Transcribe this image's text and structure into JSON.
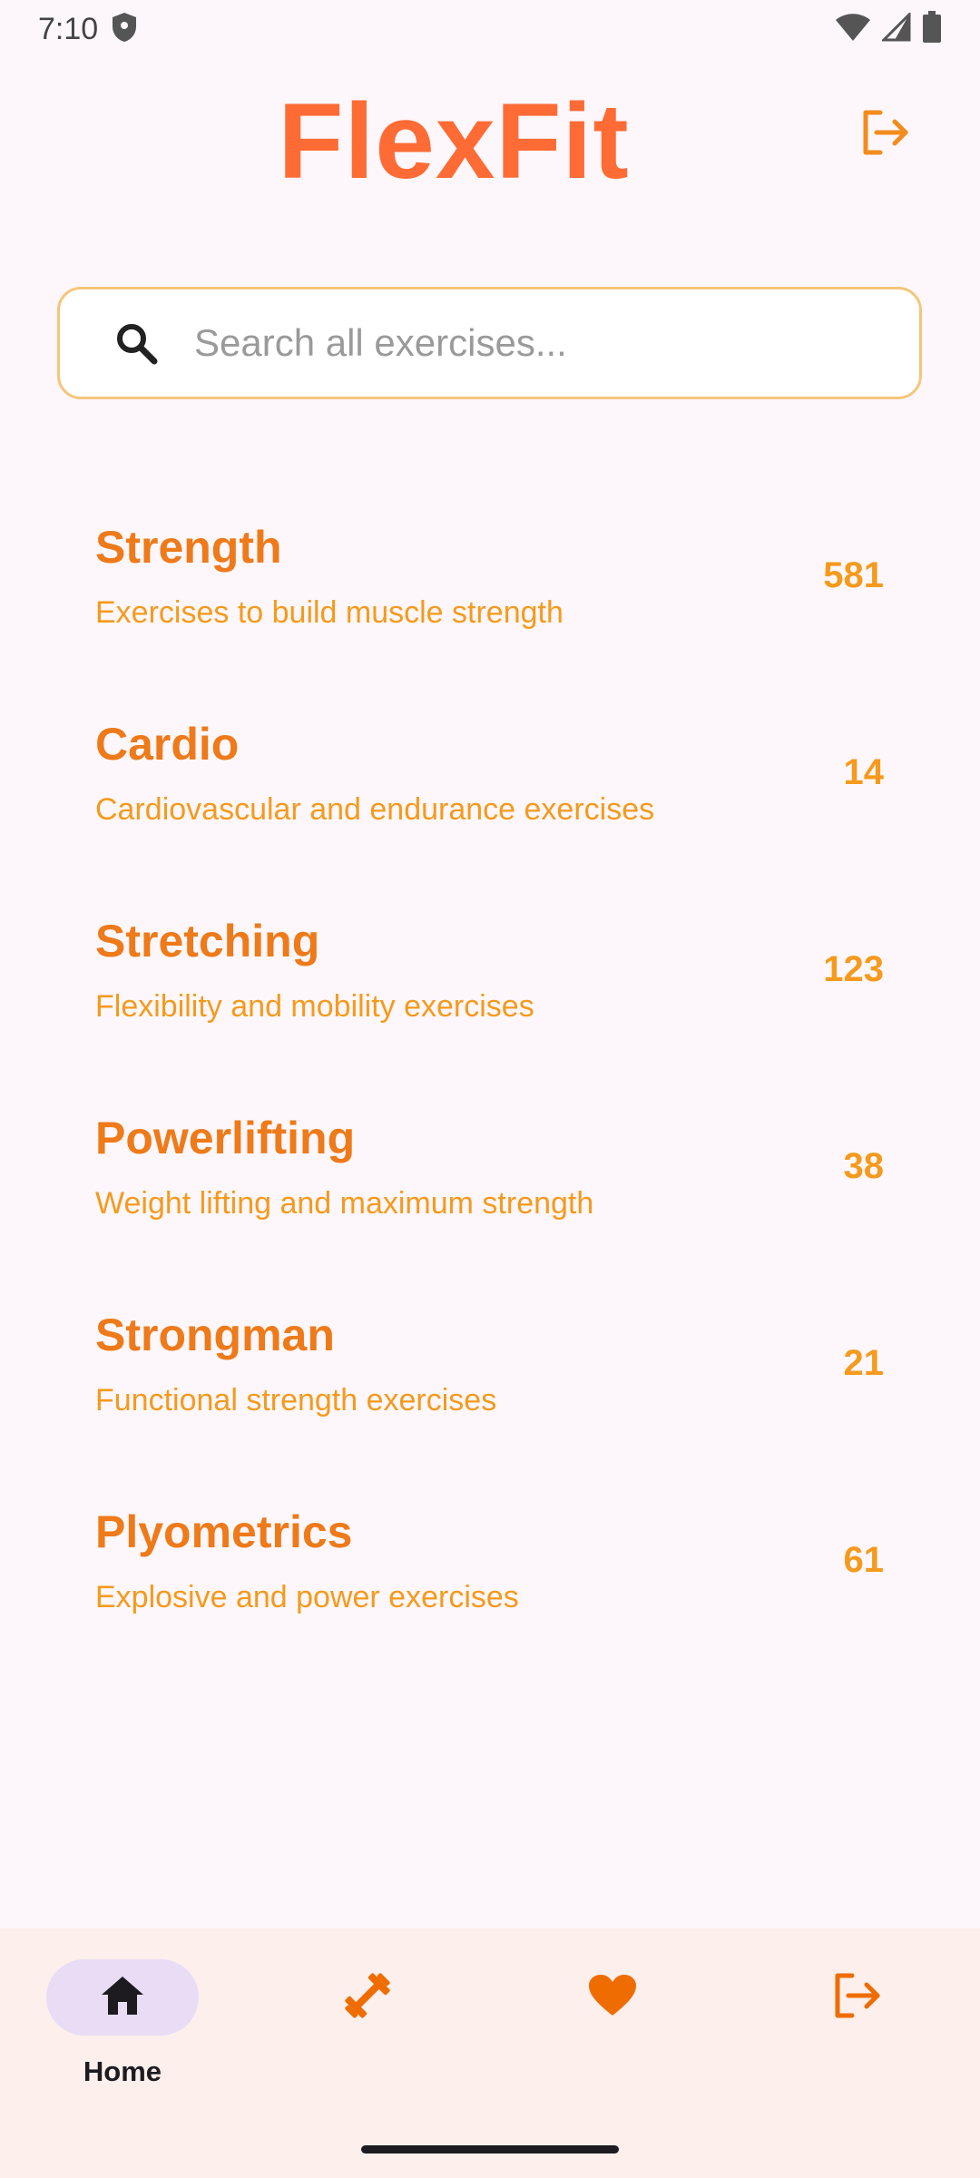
{
  "status_bar": {
    "time": "7:10",
    "icons": [
      "shield-icon",
      "wifi-icon",
      "signal-icon",
      "battery-icon"
    ]
  },
  "header": {
    "title": "FlexFit",
    "title_color": "#ff6b35",
    "action_icon": "logout-icon"
  },
  "search": {
    "placeholder": "Search all exercises...",
    "value": "",
    "icon": "search-icon",
    "border_color": "#f5c67a"
  },
  "categories": [
    {
      "name": "Strength",
      "description": "Exercises to build muscle strength",
      "count": "581"
    },
    {
      "name": "Cardio",
      "description": "Cardiovascular and endurance exercises",
      "count": "14"
    },
    {
      "name": "Stretching",
      "description": "Flexibility and mobility exercises",
      "count": "123"
    },
    {
      "name": "Powerlifting",
      "description": "Weight lifting and maximum strength",
      "count": "38"
    },
    {
      "name": "Strongman",
      "description": "Functional strength exercises",
      "count": "21"
    },
    {
      "name": "Plyometrics",
      "description": "Explosive and power exercises",
      "count": "61"
    }
  ],
  "bottom_nav": {
    "items": [
      {
        "icon": "home-icon",
        "label": "Home",
        "active": true
      },
      {
        "icon": "dumbbell-icon",
        "label": "",
        "active": false
      },
      {
        "icon": "heart-icon",
        "label": "",
        "active": false
      },
      {
        "icon": "logout-icon",
        "label": "",
        "active": false
      }
    ],
    "accent": "#ef6c00"
  },
  "colors": {
    "category_title": "#ee7a1a",
    "category_text": "#f59a1d",
    "background": "#fdf7fb",
    "nav_background": "#fcefec",
    "active_pill": "#e8ddf5"
  }
}
